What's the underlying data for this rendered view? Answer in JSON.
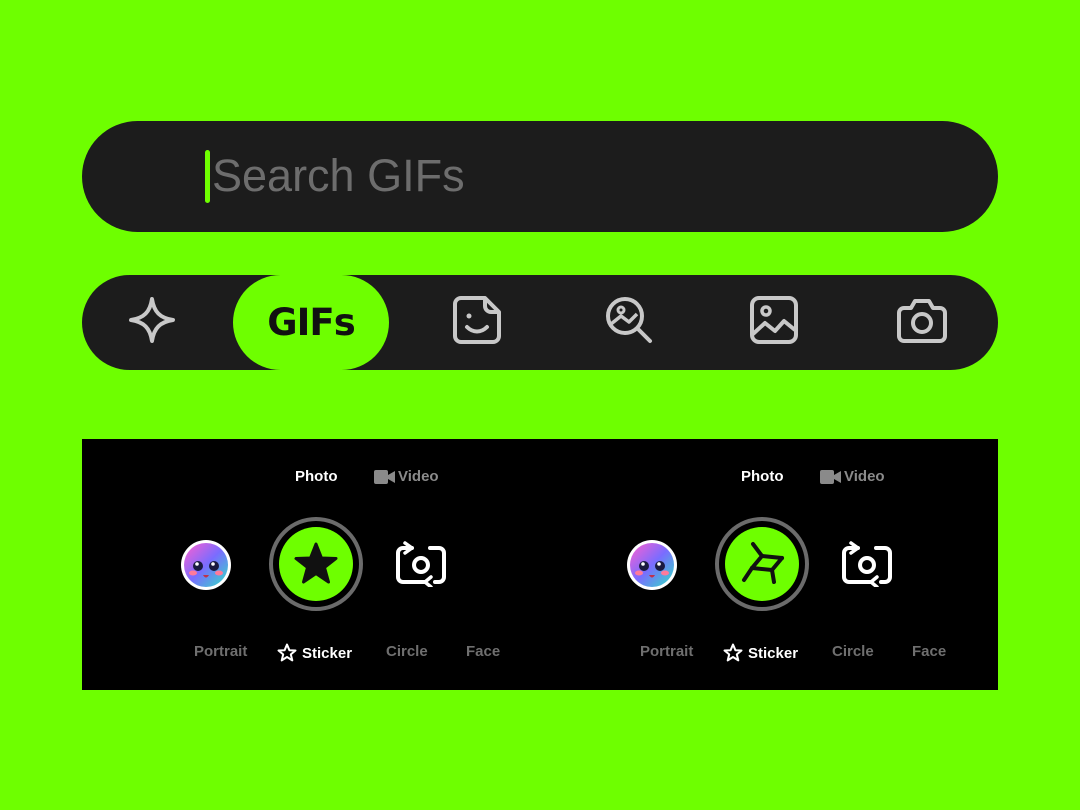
{
  "search": {
    "placeholder": "Search GIFs",
    "icon": "search-icon",
    "accent": "#6eff00"
  },
  "tabs": [
    {
      "icon": "sparkle-icon",
      "label": ""
    },
    {
      "icon": "",
      "label": "GIFs",
      "active": true
    },
    {
      "icon": "sticker-icon",
      "label": ""
    },
    {
      "icon": "image-search-icon",
      "label": ""
    },
    {
      "icon": "image-icon",
      "label": ""
    },
    {
      "icon": "camera-icon",
      "label": ""
    }
  ],
  "camera_panels": [
    {
      "modes": {
        "photo": "Photo",
        "video": "Video",
        "active": "Photo"
      },
      "shutter_icon": "star-icon",
      "options": [
        "Portrait",
        "Sticker",
        "Circle",
        "Face"
      ],
      "active_option": "Sticker"
    },
    {
      "modes": {
        "photo": "Photo",
        "video": "Video",
        "active": "Photo"
      },
      "shutter_icon": "aperture-icon",
      "options": [
        "Portrait",
        "Sticker",
        "Circle",
        "Face"
      ],
      "active_option": "Sticker"
    }
  ],
  "colors": {
    "background": "#6eff00",
    "bar": "#1c1c1c",
    "panel": "#000000",
    "icon_gray": "#c8c8c8"
  }
}
